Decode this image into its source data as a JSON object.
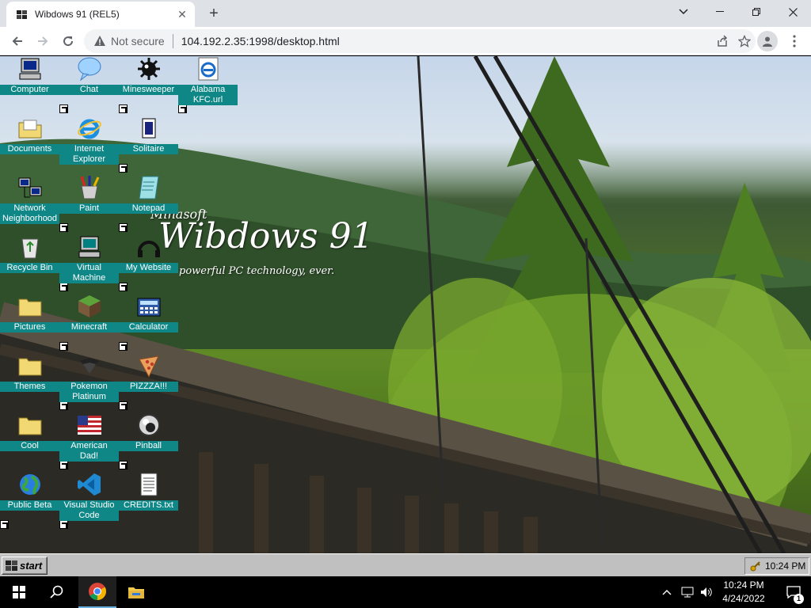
{
  "browser": {
    "tab_title": "Wibdows 91 (REL5)",
    "not_secure": "Not secure",
    "url": "104.192.2.35:1998/desktop.html"
  },
  "wallpaper": {
    "brand": "Minasoft",
    "title": "Wibdows 91",
    "tagline": "powerful PC technology, ever."
  },
  "desktop_icons": [
    {
      "label": "Computer",
      "icon": "computer-icon"
    },
    {
      "label": "Chat",
      "icon": "chat-icon"
    },
    {
      "label": "Minesweeper",
      "icon": "minesweeper-icon"
    },
    {
      "label": "Alabama KFC.url",
      "icon": "ie-link-icon"
    },
    {
      "label": "Documents",
      "icon": "documents-folder-icon"
    },
    {
      "label": "Internet Explorer",
      "icon": "internet-explorer-icon"
    },
    {
      "label": "Solitaire",
      "icon": "solitaire-icon"
    },
    {
      "label": "Network Neighborhood",
      "icon": "network-icon"
    },
    {
      "label": "Paint",
      "icon": "paint-icon"
    },
    {
      "label": "Notepad",
      "icon": "notepad-icon"
    },
    {
      "label": "Recycle Bin",
      "icon": "recycle-bin-icon"
    },
    {
      "label": "Virtual Machine",
      "icon": "virtual-machine-icon"
    },
    {
      "label": "My Website",
      "icon": "website-icon"
    },
    {
      "label": "Pictures",
      "icon": "folder-icon"
    },
    {
      "label": "Minecraft",
      "icon": "minecraft-icon"
    },
    {
      "label": "Calculator",
      "icon": "calculator-icon"
    },
    {
      "label": "Themes",
      "icon": "folder-icon"
    },
    {
      "label": "Pokemon Platinum",
      "icon": "pokemon-icon"
    },
    {
      "label": "PIZZZA!!!",
      "icon": "pizza-icon"
    },
    {
      "label": "Cool",
      "icon": "folder-icon"
    },
    {
      "label": "American Dad!",
      "icon": "american-flag-icon"
    },
    {
      "label": "Pinball",
      "icon": "pinball-icon"
    },
    {
      "label": "Public Beta",
      "icon": "globe-icon"
    },
    {
      "label": "Visual Studio Code",
      "icon": "vscode-icon"
    },
    {
      "label": "CREDITS.txt",
      "icon": "text-file-icon"
    }
  ],
  "w95_taskbar": {
    "start": "start",
    "clock": "10:24 PM"
  },
  "os_taskbar": {
    "time": "10:24 PM",
    "date": "4/24/2022",
    "notifications": "1"
  }
}
